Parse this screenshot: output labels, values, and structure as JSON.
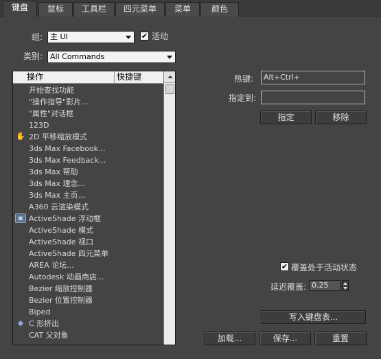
{
  "tabs": [
    "键盘",
    "鼠标",
    "工具栏",
    "四元菜单",
    "菜单",
    "颜色"
  ],
  "group_label": "组:",
  "group_value": "主 UI",
  "active_label": "活动",
  "active_checked": true,
  "category_label": "类别:",
  "category_value": "All Commands",
  "list": {
    "col_action": "操作",
    "col_shortcut": "快捷键",
    "items": [
      {
        "label": "开始查找功能",
        "icon": ""
      },
      {
        "label": "\"操作指导\"影片...",
        "icon": ""
      },
      {
        "label": "\"属性\"对话框",
        "icon": ""
      },
      {
        "label": "123D",
        "icon": ""
      },
      {
        "label": "2D 平移缩放模式",
        "icon": "hand-icon"
      },
      {
        "label": "3ds Max Facebook...",
        "icon": ""
      },
      {
        "label": "3ds Max Feedback...",
        "icon": ""
      },
      {
        "label": "3ds Max 帮助",
        "icon": ""
      },
      {
        "label": "3ds Max 理念...",
        "icon": ""
      },
      {
        "label": "3ds Max 主页...",
        "icon": ""
      },
      {
        "label": "A360 云渲染模式",
        "icon": ""
      },
      {
        "label": "ActiveShade 浮动框",
        "icon": "activeshade-icon"
      },
      {
        "label": "ActiveShade 模式",
        "icon": ""
      },
      {
        "label": "ActiveShade 视口",
        "icon": ""
      },
      {
        "label": "ActiveShade 四元菜单",
        "icon": ""
      },
      {
        "label": "AREA 论坛...",
        "icon": ""
      },
      {
        "label": "Autodesk 动画商店...",
        "icon": ""
      },
      {
        "label": "Bezier 缩放控制器",
        "icon": ""
      },
      {
        "label": "Bezier 位置控制器",
        "icon": ""
      },
      {
        "label": "Biped",
        "icon": ""
      },
      {
        "label": "C 形挤出",
        "icon": "c-extrusion-icon"
      },
      {
        "label": "CAT 父对象",
        "icon": ""
      }
    ]
  },
  "hotkey_label": "热键:",
  "hotkey_value": "Alt+Ctrl+",
  "assigned_to_label": "指定到:",
  "assigned_to_value": "",
  "assign_button": "指定",
  "remove_button": "移除",
  "override_label": "覆盖处于活动状态",
  "override_checked": true,
  "delay_label": "延迟覆盖:",
  "delay_value": "0.25",
  "write_button": "写入键盘表...",
  "load_button": "加载...",
  "save_button": "保存...",
  "reset_button": "重置"
}
